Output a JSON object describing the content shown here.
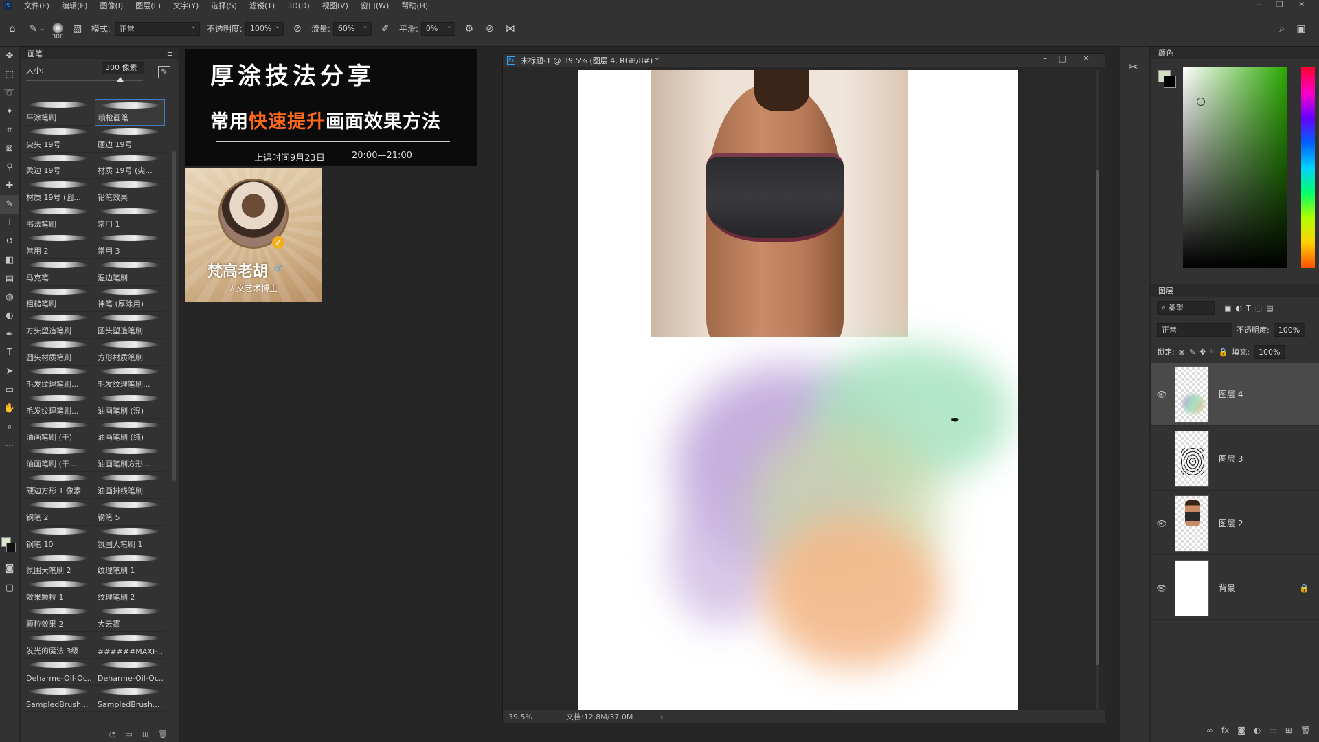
{
  "menubar": {
    "items": [
      "文件(F)",
      "编辑(E)",
      "图像(I)",
      "图层(L)",
      "文字(Y)",
      "选择(S)",
      "滤镜(T)",
      "3D(D)",
      "视图(V)",
      "窗口(W)",
      "帮助(H)"
    ]
  },
  "options": {
    "brush_size": "300",
    "mode_label": "模式:",
    "mode_value": "正常",
    "opacity_label": "不透明度:",
    "opacity_value": "100%",
    "flow_label": "流量:",
    "flow_value": "60%",
    "smooth_label": "平滑:",
    "smooth_value": "0%"
  },
  "brush_panel": {
    "title": "画笔",
    "size_label": "大小:",
    "size_value": "300 像素",
    "brushes": [
      "平涂笔刷",
      "喷枪画笔",
      "尖头 19号",
      "硬边 19号",
      "柔边 19号",
      "材质 19号 (尖...",
      "材质 19号 (圆...",
      "铅笔效果",
      "书法笔刷",
      "常用 1",
      "常用 2",
      "常用 3",
      "马克笔",
      "湿边笔刷",
      "粗糙笔刷",
      "神笔 (厚涂用)",
      "方头塑造笔刷",
      "圆头塑造笔刷",
      "圆头材质笔刷",
      "方形材质笔刷",
      "毛发纹理笔刷...",
      "毛发纹理笔刷...",
      "毛发纹理笔刷...",
      "油画笔刷 (湿)",
      "油画笔刷 (干)",
      "油画笔刷 (纯)",
      "油画笔刷 (干...",
      "油画笔刷方形...",
      "硬边方形 1 像素",
      "油画排线笔刷",
      "钢笔 2",
      "钢笔 5",
      "钢笔 10",
      "氛围大笔刷 1",
      "氛围大笔刷 2",
      "纹理笔刷 1",
      "效果颗粒 1",
      "纹理笔刷 2",
      "颗粒效果 2",
      "大云雾",
      "发光的魔法 3级",
      "######MAXH...",
      "Deharme-Oil-Oc...",
      "Deharme-Oil-Oc...",
      "SampledBrush...",
      "SampledBrush..."
    ],
    "selected_index": 1
  },
  "banner": {
    "title": "厚涂技法分享",
    "subtitle_pre": "常用",
    "subtitle_highlight": "快速提升",
    "subtitle_post": "画面效果方法",
    "date": "上课时间9月23日",
    "time": "20:00—21:00"
  },
  "profile": {
    "name": "梵高老胡",
    "tagline": "人文艺术博主"
  },
  "document": {
    "title": "未标题-1 @ 39.5% (图层 4, RGB/8#) *",
    "zoom": "39.5%",
    "doc_info": "文档:12.8M/37.0M"
  },
  "panels": {
    "color_title": "颜色",
    "layers_title": "图层",
    "kind_label": "类型",
    "blend_mode": "正常",
    "opacity_label": "不透明度:",
    "opacity_value": "100%",
    "lock_label": "锁定:",
    "fill_label": "填充:",
    "fill_value": "100%"
  },
  "layers": [
    {
      "name": "图层 4",
      "visible": true,
      "selected": true
    },
    {
      "name": "图层 3",
      "visible": false,
      "selected": false
    },
    {
      "name": "图层 2",
      "visible": true,
      "selected": false
    },
    {
      "name": "背景",
      "visible": true,
      "selected": false,
      "locked": true
    }
  ],
  "colors": {
    "accent": "#31a8ff",
    "highlight": "#ff6a1a",
    "foreground": "#d9e8c9",
    "background": "#000000"
  }
}
